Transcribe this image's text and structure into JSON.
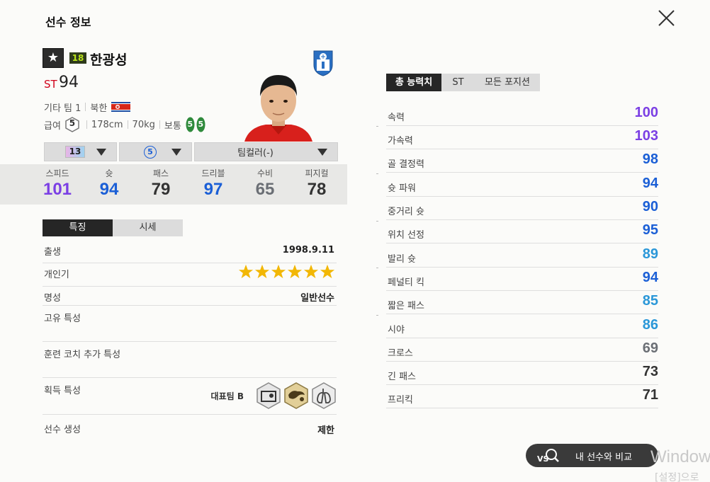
{
  "header": {
    "title": "선수 정보"
  },
  "player": {
    "season_badge": "18",
    "name": "한광성",
    "position": "ST",
    "overall": "94",
    "club": "기타 팀 1",
    "nation": "북한",
    "salary_label": "급여",
    "salary": "5",
    "height": "178cm",
    "weight": "70kg",
    "body_type": "보통",
    "foot_left": "5",
    "foot_right": "5"
  },
  "controls": {
    "upgrade_level": "13",
    "salary_select": "5",
    "team_color": "팀컬러(-)"
  },
  "stats": [
    {
      "label": "스피드",
      "value": "101",
      "color": "#7b3fe4"
    },
    {
      "label": "슛",
      "value": "94",
      "color": "#1b5fd6"
    },
    {
      "label": "패스",
      "value": "79",
      "color": "#333333"
    },
    {
      "label": "드리블",
      "value": "97",
      "color": "#1b5fd6"
    },
    {
      "label": "수비",
      "value": "65",
      "color": "#6b6f75"
    },
    {
      "label": "피지컬",
      "value": "78",
      "color": "#333333"
    }
  ],
  "tabs": {
    "traits": "특징",
    "market": "시세"
  },
  "details": {
    "birth_label": "출생",
    "birth_value": "1998.9.11",
    "popularity_label": "개인기",
    "popularity_stars": 6,
    "fame_label": "명성",
    "fame_value": "일반선수",
    "unique_trait_label": "고유 특성",
    "coach_trait_label": "훈련 코치 추가 특성",
    "acquired_trait_label": "획득 특성",
    "acquired_trait_team": "대표팀 B",
    "creation_label": "선수 생성",
    "creation_value": "제한"
  },
  "right_tabs": [
    "총 능력치",
    "ST",
    "모든 포지션"
  ],
  "attributes": [
    {
      "label": "속력",
      "value": "100",
      "color": "#7b3fe4"
    },
    {
      "label": "가속력",
      "value": "103",
      "color": "#7b3fe4"
    },
    {
      "label": "골 결정력",
      "value": "98",
      "color": "#1b5fd6"
    },
    {
      "label": "슛 파워",
      "value": "94",
      "color": "#1b5fd6"
    },
    {
      "label": "중거리 슛",
      "value": "90",
      "color": "#1b5fd6"
    },
    {
      "label": "위치 선정",
      "value": "95",
      "color": "#1b5fd6"
    },
    {
      "label": "발리 슛",
      "value": "89",
      "color": "#2a97d8"
    },
    {
      "label": "페널티 킥",
      "value": "94",
      "color": "#1b5fd6"
    },
    {
      "label": "짧은 패스",
      "value": "85",
      "color": "#2a97d8"
    },
    {
      "label": "시야",
      "value": "86",
      "color": "#2a97d8"
    },
    {
      "label": "크로스",
      "value": "69",
      "color": "#6b6f75"
    },
    {
      "label": "긴 패스",
      "value": "73",
      "color": "#333333"
    },
    {
      "label": "프리킥",
      "value": "71",
      "color": "#333333"
    }
  ],
  "compare": {
    "label": "내 선수와 비교",
    "icon": "VS"
  },
  "watermark": {
    "line1": "Window",
    "line2": "[설정]으로"
  }
}
